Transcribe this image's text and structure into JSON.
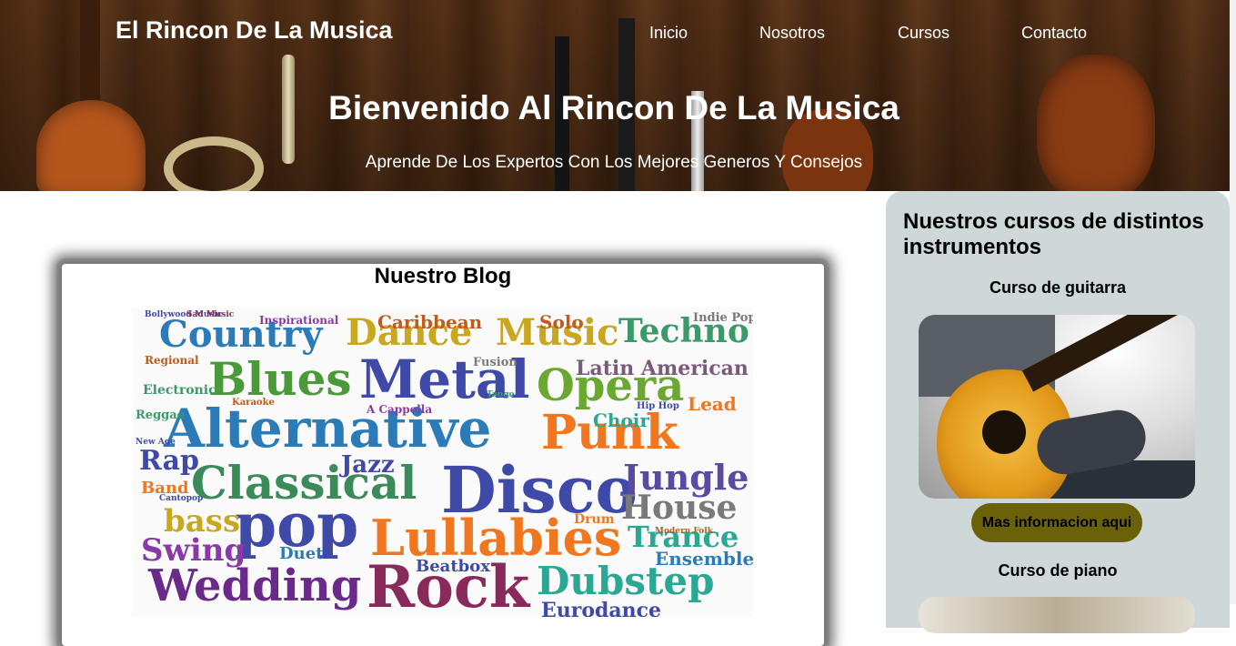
{
  "header": {
    "brand": "El Rincon De La Musica",
    "nav": [
      "Inicio",
      "Nosotros",
      "Cursos",
      "Contacto"
    ],
    "title": "Bienvenido Al Rincon De La Musica",
    "subtitle": "Aprende De Los Expertos Con Los Mejores Generos Y Consejos"
  },
  "blog": {
    "title": "Nuestro Blog",
    "cloud_words": [
      "Country",
      "Dance",
      "Music",
      "Techno",
      "Blues",
      "Metal",
      "Opera",
      "Latin American",
      "Alternative",
      "Punk",
      "Classical",
      "Jazz",
      "Disco",
      "Jungle",
      "House",
      "pop",
      "Lullabies",
      "Trance",
      "bass",
      "Swing",
      "Ensemble",
      "Wedding",
      "Rock",
      "Dubstep",
      "Caribbean",
      "Solo",
      "Inspirational",
      "Indie Pop",
      "Fusion",
      "Rap",
      "Choir",
      "Regional",
      "Electronic",
      "Lead",
      "Band",
      "Duet",
      "Beatbox",
      "Reggae",
      "Drum",
      "Eurodance",
      "Modern Folk",
      "Hip Hop",
      "A Cappella",
      "Bollywood Music",
      "Karaoke",
      "New Age",
      "Cantopop",
      "Sad Music",
      "Tango"
    ]
  },
  "aside": {
    "title": "Nuestros cursos de distintos instrumentos",
    "courses": [
      {
        "title": "Curso de guitarra",
        "button": "Mas informacion aqui"
      },
      {
        "title": "Curso de piano"
      }
    ]
  }
}
